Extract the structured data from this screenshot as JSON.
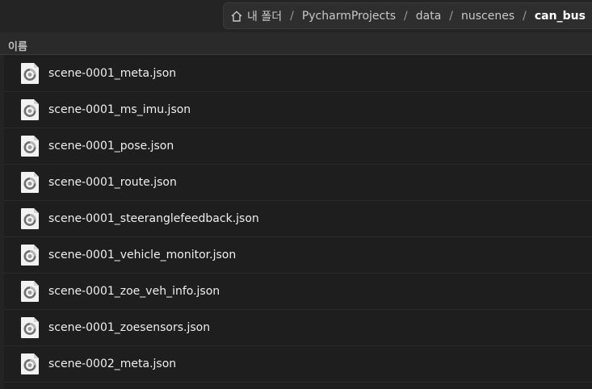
{
  "breadcrumb": {
    "items": [
      {
        "label": "내 폴더",
        "current": false
      },
      {
        "label": "PycharmProjects",
        "current": false
      },
      {
        "label": "data",
        "current": false
      },
      {
        "label": "nuscenes",
        "current": false
      },
      {
        "label": "can_bus",
        "current": true
      }
    ],
    "separator": "/"
  },
  "list_header": {
    "name_column": "이름"
  },
  "files": [
    {
      "name": "scene-0001_meta.json",
      "icon": "json-file-icon"
    },
    {
      "name": "scene-0001_ms_imu.json",
      "icon": "json-file-icon"
    },
    {
      "name": "scene-0001_pose.json",
      "icon": "json-file-icon"
    },
    {
      "name": "scene-0001_route.json",
      "icon": "json-file-icon"
    },
    {
      "name": "scene-0001_steeranglefeedback.json",
      "icon": "json-file-icon"
    },
    {
      "name": "scene-0001_vehicle_monitor.json",
      "icon": "json-file-icon"
    },
    {
      "name": "scene-0001_zoe_veh_info.json",
      "icon": "json-file-icon"
    },
    {
      "name": "scene-0001_zoesensors.json",
      "icon": "json-file-icon"
    },
    {
      "name": "scene-0002_meta.json",
      "icon": "json-file-icon"
    }
  ],
  "colors": {
    "background": "#1e1e1e",
    "pathbar": "#2e2e2e",
    "text": "#eeeeee"
  }
}
